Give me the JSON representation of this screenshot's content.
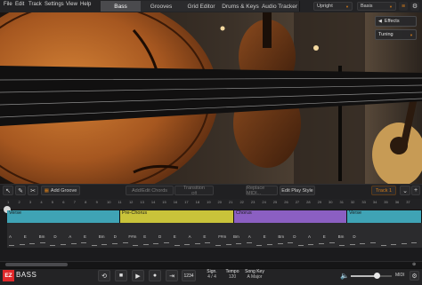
{
  "menu": [
    "File",
    "Edit",
    "Track",
    "Settings",
    "View",
    "Help"
  ],
  "tabs": [
    {
      "label": "Bass",
      "active": true
    },
    {
      "label": "Grooves",
      "active": false
    },
    {
      "label": "Grid Editor",
      "active": false
    },
    {
      "label": "Drums & Keys",
      "active": false
    },
    {
      "label": "Audio Tracker",
      "active": false
    }
  ],
  "header": {
    "instrument": "Upright",
    "preset": "Basis"
  },
  "hero": {
    "effects_label": "Effects",
    "tuning_label": "Tuning"
  },
  "toolbar": {
    "add_groove": "Add Groove",
    "add_edit_chords": "Add/Edit Chords",
    "transition": "Transition",
    "transition_value": "Off",
    "replace_midi": "Replace MIDI...",
    "edit_play_style": "Edit Play Style",
    "track_name": "Track 1"
  },
  "timeline": {
    "bar_numbers": [
      "1",
      "2",
      "3",
      "4",
      "5",
      "6",
      "7",
      "8",
      "9",
      "10",
      "11",
      "12",
      "13",
      "14",
      "15",
      "16",
      "17",
      "18",
      "19",
      "20",
      "21",
      "22",
      "23",
      "24",
      "25",
      "26",
      "27",
      "28",
      "29",
      "30",
      "31",
      "32",
      "33",
      "34",
      "35",
      "36",
      "37"
    ],
    "parts": [
      {
        "label": "Verse",
        "color": "#3fa3b5"
      },
      {
        "label": "Pre-Chorus",
        "color": "#c9c33a"
      },
      {
        "label": "Chorus",
        "color": "#8b5fc2"
      },
      {
        "label": "Verse",
        "color": "#3fa3b5"
      }
    ],
    "chords": [
      "A",
      "E",
      "Bm",
      "D",
      "A",
      "E",
      "Bm",
      "D",
      "F#m",
      "E",
      "D",
      "E",
      "A",
      "E",
      "F#m",
      "Bm",
      "A",
      "E",
      "Bm",
      "D",
      "A",
      "E",
      "Bm",
      "D"
    ]
  },
  "transport": {
    "signature_label": "Sign.",
    "signature_value": "4 / 4",
    "tempo_label": "Tempo",
    "tempo_value": "120",
    "key_label": "Song Key",
    "key_value": "A Major",
    "midi_label": "MIDI",
    "brand_badge": "EZ",
    "brand_name": "BASS"
  },
  "colors": {
    "accent": "#d07a1a",
    "verse": "#3fa3b5",
    "prechorus": "#c9c33a",
    "chorus": "#8b5fc2"
  }
}
